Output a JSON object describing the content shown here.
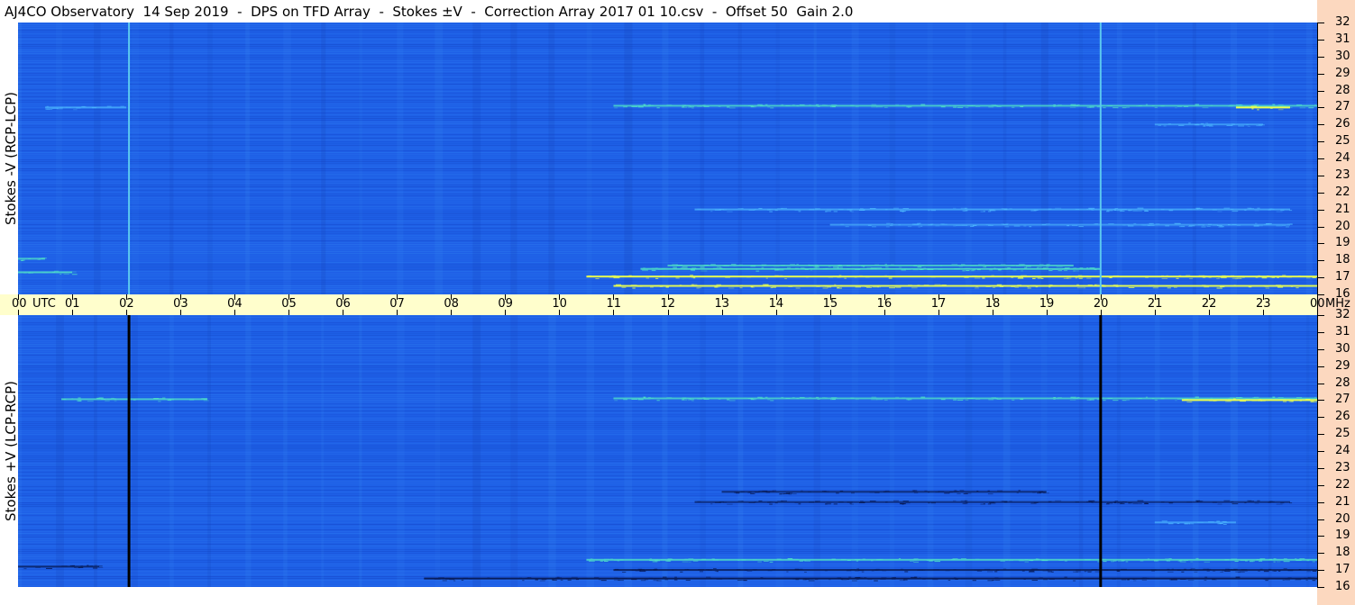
{
  "title": "AJ4CO Observatory  14 Sep 2019  -  DPS on TFD Array  -  Stokes ±V  -  Correction Array 2017 01 10.csv  -  Offset 50  Gain 2.0",
  "colors": {
    "background": "#1e5fe6",
    "time_axis_bg": "#fffecc",
    "freq_axis_bg": "#fcd8bf",
    "marker_top": "#5bc8f0",
    "marker_bottom": "#000000"
  },
  "chart_data": [
    {
      "type": "heatmap",
      "panel": "top",
      "ylabel": "Stokes -V (RCP-LCP)",
      "x_unit": "UTC",
      "x_ticks": [
        "00",
        "01",
        "02",
        "03",
        "04",
        "05",
        "06",
        "07",
        "08",
        "09",
        "10",
        "11",
        "12",
        "13",
        "14",
        "15",
        "16",
        "17",
        "18",
        "19",
        "20",
        "21",
        "22",
        "23",
        "00"
      ],
      "xlim": [
        0,
        24
      ],
      "y_unit": "MHz",
      "y_ticks": [
        "16",
        "17",
        "18",
        "19",
        "20",
        "21",
        "22",
        "23",
        "24",
        "25",
        "26",
        "27",
        "28",
        "29",
        "30",
        "31",
        "32"
      ],
      "ylim": [
        16,
        32
      ],
      "marker_times_utc": [
        2.05,
        20.0
      ],
      "features": [
        {
          "freq": 16.5,
          "t_start": 11.0,
          "t_end": 24.0,
          "intensity": 0.9
        },
        {
          "freq": 17.05,
          "t_start": 10.5,
          "t_end": 24.0,
          "intensity": 1.0
        },
        {
          "freq": 17.5,
          "t_start": 11.5,
          "t_end": 20.0,
          "intensity": 0.8
        },
        {
          "freq": 17.7,
          "t_start": 12.0,
          "t_end": 19.5,
          "intensity": 0.6
        },
        {
          "freq": 17.3,
          "t_start": 0.0,
          "t_end": 1.0,
          "intensity": 0.7
        },
        {
          "freq": 18.1,
          "t_start": 0.0,
          "t_end": 0.5,
          "intensity": 0.6
        },
        {
          "freq": 27.0,
          "t_start": 0.5,
          "t_end": 2.0,
          "intensity": 0.5
        },
        {
          "freq": 27.1,
          "t_start": 11.0,
          "t_end": 24.0,
          "intensity": 0.6
        },
        {
          "freq": 27.0,
          "t_start": 22.5,
          "t_end": 23.5,
          "intensity": 1.0
        },
        {
          "freq": 21.0,
          "t_start": 12.5,
          "t_end": 23.5,
          "intensity": 0.5
        },
        {
          "freq": 20.1,
          "t_start": 15.0,
          "t_end": 23.5,
          "intensity": 0.4
        },
        {
          "freq": 26.0,
          "t_start": 21.0,
          "t_end": 23.0,
          "intensity": 0.3
        }
      ]
    },
    {
      "type": "heatmap",
      "panel": "bottom",
      "ylabel": "Stokes +V (LCP-RCP)",
      "x_unit": "UTC",
      "x_ticks": [
        "00",
        "01",
        "02",
        "03",
        "04",
        "05",
        "06",
        "07",
        "08",
        "09",
        "10",
        "11",
        "12",
        "13",
        "14",
        "15",
        "16",
        "17",
        "18",
        "19",
        "20",
        "21",
        "22",
        "23",
        "00"
      ],
      "xlim": [
        0,
        24
      ],
      "y_unit": "MHz",
      "y_ticks": [
        "16",
        "17",
        "18",
        "19",
        "20",
        "21",
        "22",
        "23",
        "24",
        "25",
        "26",
        "27",
        "28",
        "29",
        "30",
        "31",
        "32"
      ],
      "ylim": [
        16,
        32
      ],
      "marker_times_utc": [
        2.05,
        20.0
      ],
      "features": [
        {
          "freq": 17.6,
          "t_start": 10.5,
          "t_end": 24.0,
          "intensity": 0.7
        },
        {
          "freq": 16.5,
          "t_start": 7.5,
          "t_end": 24.0,
          "intensity": -0.9
        },
        {
          "freq": 17.0,
          "t_start": 11.0,
          "t_end": 24.0,
          "intensity": -0.7
        },
        {
          "freq": 17.2,
          "t_start": 0.0,
          "t_end": 1.5,
          "intensity": -0.6
        },
        {
          "freq": 27.05,
          "t_start": 0.8,
          "t_end": 3.5,
          "intensity": 0.6
        },
        {
          "freq": 27.1,
          "t_start": 11.0,
          "t_end": 24.0,
          "intensity": 0.6
        },
        {
          "freq": 27.0,
          "t_start": 21.5,
          "t_end": 24.0,
          "intensity": 1.0
        },
        {
          "freq": 21.6,
          "t_start": 13.0,
          "t_end": 19.0,
          "intensity": -0.5
        },
        {
          "freq": 21.0,
          "t_start": 12.5,
          "t_end": 23.5,
          "intensity": -0.4
        },
        {
          "freq": 19.8,
          "t_start": 21.0,
          "t_end": 22.5,
          "intensity": 0.4
        }
      ]
    }
  ]
}
